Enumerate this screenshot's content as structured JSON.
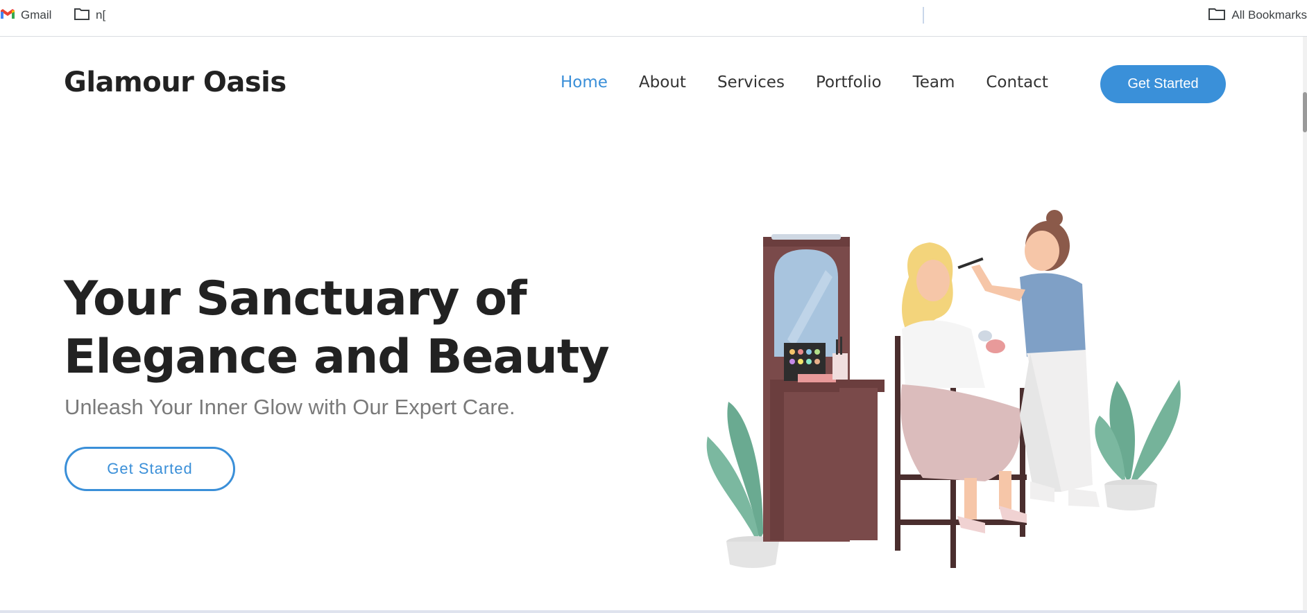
{
  "bookmarks": {
    "gmail_label": "Gmail",
    "folder_label": "n[",
    "all_label": "All Bookmarks"
  },
  "site": {
    "logo": "Glamour Oasis",
    "nav": [
      "Home",
      "About",
      "Services",
      "Portfolio",
      "Team",
      "Contact"
    ],
    "active_nav": "Home",
    "cta_label": "Get Started"
  },
  "hero": {
    "title_line1": "Your Sanctuary of",
    "title_line2": "Elegance and Beauty",
    "subtitle": "Unleash Your Inner Glow with Our Expert Care.",
    "button_label": "Get Started"
  },
  "colors": {
    "accent": "#3a8fd8",
    "heading": "#222222",
    "subtitle": "#7a7a7a"
  },
  "icons": {
    "gmail": "gmail-icon",
    "folder": "folder-icon",
    "illustration": "makeup-artist-illustration"
  }
}
